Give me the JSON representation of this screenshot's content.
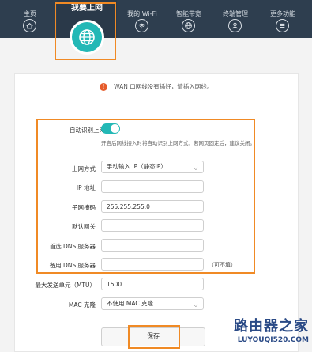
{
  "nav": {
    "items": [
      {
        "label": "主页",
        "icon": "home-icon"
      },
      {
        "label": "我要上网",
        "icon": "globe-icon"
      },
      {
        "label": "我的 Wi-Fi",
        "icon": "wifi-icon"
      },
      {
        "label": "智能带宽",
        "icon": "globe-icon"
      },
      {
        "label": "终端管理",
        "icon": "user-icon"
      },
      {
        "label": "更多功能",
        "icon": "menu-icon"
      }
    ],
    "active": "我要上网",
    "accent": "#23b8b6",
    "bar_color": "#2e3e4f"
  },
  "warning": {
    "icon": "!",
    "text": "WAN 口网线没有插好，请插入网线。",
    "color": "#e65c2b"
  },
  "form": {
    "auto_detect": {
      "label": "自动识别上网方式",
      "enabled": true
    },
    "hint": "开启后网线接入时将自动识别上网方式，若网页固定后，建议关闭。",
    "connection": {
      "label": "上网方式",
      "value": "手动输入 IP（静态IP）"
    },
    "ip": {
      "label": "IP 地址",
      "value": ""
    },
    "mask": {
      "label": "子网掩码",
      "value": "255.255.255.0"
    },
    "gateway": {
      "label": "默认网关",
      "value": ""
    },
    "dns1": {
      "label": "首选 DNS 服务器",
      "value": ""
    },
    "dns2": {
      "label": "备用 DNS 服务器",
      "value": "",
      "optional": "（可不填）"
    },
    "mtu": {
      "label": "最大发送单元（MTU）",
      "value": "1500"
    },
    "mac": {
      "label": "MAC 克隆",
      "value": "不使用 MAC 克隆"
    },
    "save": "保存"
  },
  "watermark": {
    "title": "路由器之家",
    "url": "LUYOUQI520.COM",
    "color": "#2a4a86"
  },
  "highlight_color": "#f08a25"
}
